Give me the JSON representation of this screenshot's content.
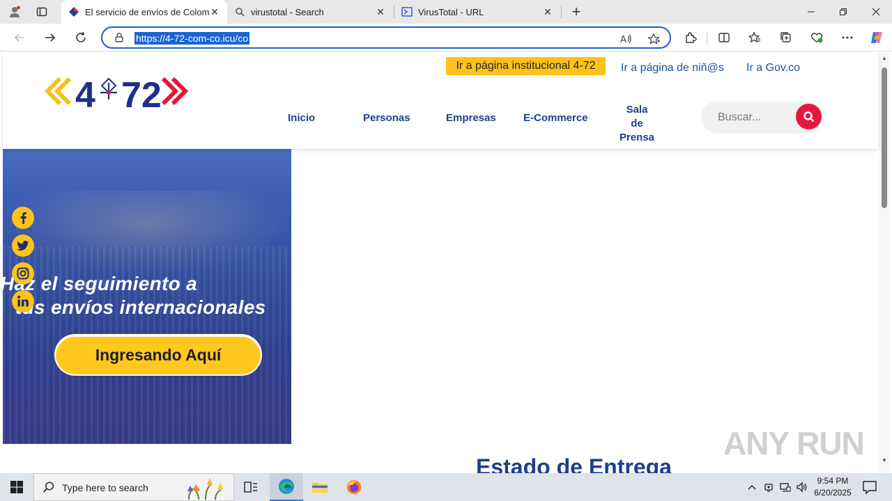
{
  "browser": {
    "tabs": [
      {
        "title": "El servicio de envíos de Colombia",
        "active": true
      },
      {
        "title": "virustotal - Search",
        "active": false
      },
      {
        "title": "VirusTotal - URL",
        "active": false
      }
    ],
    "url": "https://4-72-com-co.icu/co"
  },
  "site": {
    "logo_text": "4-72",
    "institutional_button": "Ir a página institucional 4-72",
    "top_links": [
      "Ir a página de niñ@s",
      "Ir a Gov.co"
    ],
    "nav": [
      "Inicio",
      "Personas",
      "Empresas",
      "E-Commerce"
    ],
    "nav_sala": [
      "Sala",
      "de",
      "Prensa"
    ],
    "search_placeholder": "Buscar...",
    "banner": {
      "line1": "Haz el seguimiento a",
      "line2": "tus envíos internacionales",
      "cta": "Ingresando Aquí"
    },
    "section_heading": "Estado de Entrega",
    "social": [
      "facebook",
      "twitter",
      "instagram",
      "linkedin"
    ]
  },
  "watermark": "ANY RUN",
  "taskbar": {
    "search_placeholder": "Type here to search",
    "time": "9:54 PM",
    "date": "6/20/2025"
  },
  "colors": {
    "accent_yellow": "#ffc21a",
    "brand_blue": "#1d3f8c",
    "brand_red": "#e5183c",
    "omnibox_border": "#1a5fd6"
  }
}
